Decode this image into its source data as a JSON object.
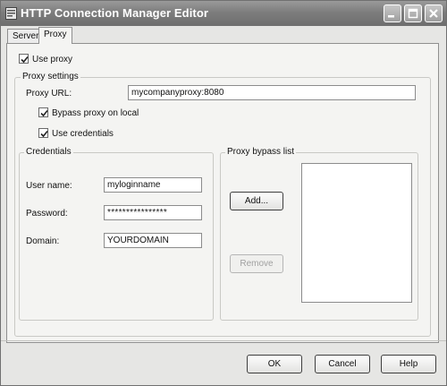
{
  "window": {
    "title": "HTTP Connection Manager Editor"
  },
  "tabs": [
    {
      "label": "Server",
      "active": false
    },
    {
      "label": "Proxy",
      "active": true
    }
  ],
  "proxy": {
    "use_proxy_label": "Use proxy",
    "use_proxy_checked": true,
    "settings_group_title": "Proxy settings",
    "url_label": "Proxy URL:",
    "url_value": "mycompanyproxy:8080",
    "bypass_local_label": "Bypass proxy on local",
    "bypass_local_checked": true,
    "use_credentials_label": "Use credentials",
    "use_credentials_checked": true
  },
  "credentials": {
    "group_title": "Credentials",
    "username_label": "User name:",
    "username_value": "myloginname",
    "password_label": "Password:",
    "password_value": "****************",
    "domain_label": "Domain:",
    "domain_value": "YOURDOMAIN"
  },
  "bypass_list": {
    "group_title": "Proxy bypass list",
    "add_label": "Add...",
    "remove_label": "Remove",
    "remove_enabled": false,
    "items": []
  },
  "footer": {
    "ok_label": "OK",
    "cancel_label": "Cancel",
    "help_label": "Help"
  },
  "icons": {
    "app": "dialog-app-icon",
    "minimize": "minimize-icon",
    "maximize": "maximize-icon",
    "close": "close-icon",
    "check": "checkmark-icon"
  },
  "colors": {
    "titlebar": "#7d7d7d",
    "dialog_bg": "#e6e6e4",
    "panel_bg": "#f4f4f2",
    "disabled_text": "#a0a0a0"
  }
}
